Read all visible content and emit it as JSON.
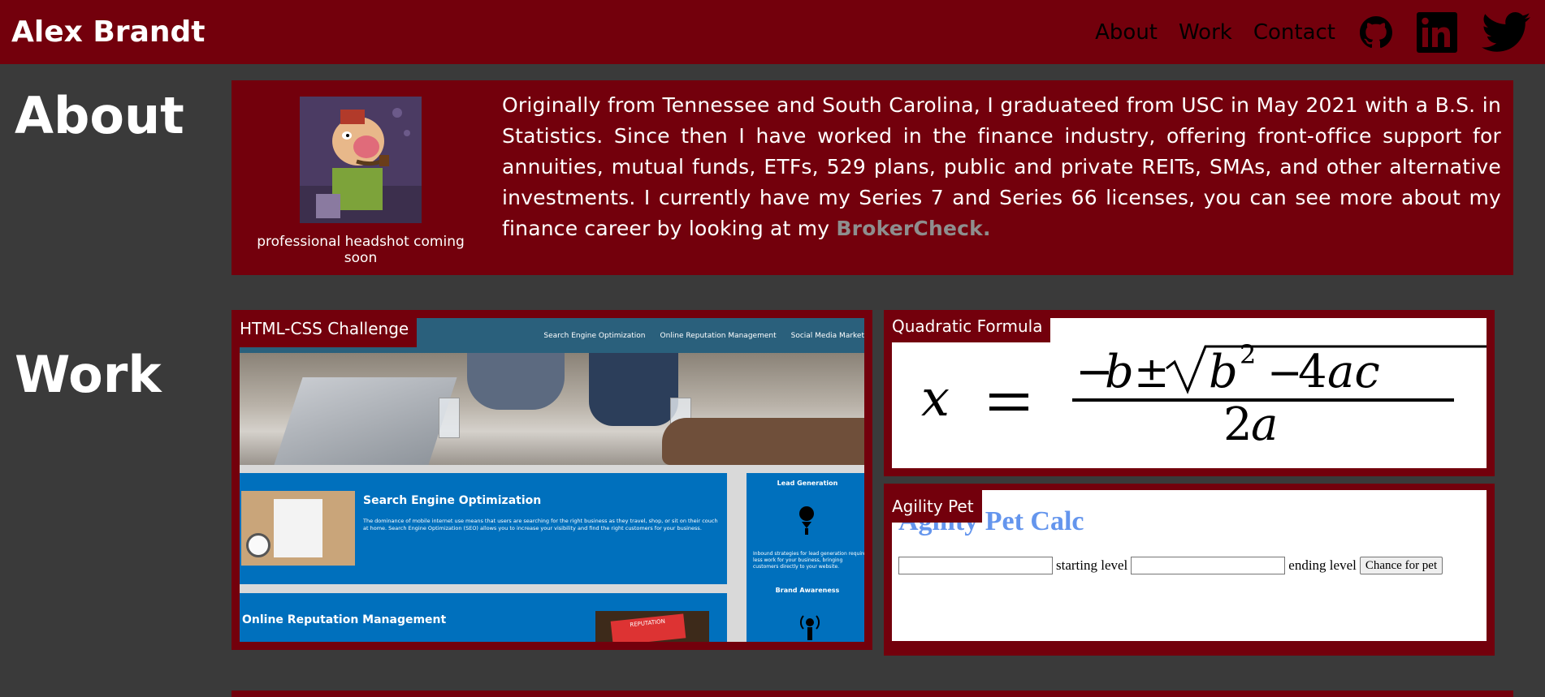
{
  "header": {
    "brand": "Alex Brandt",
    "nav": [
      "About",
      "Work",
      "Contact"
    ],
    "icons": [
      "github-icon",
      "linkedin-icon",
      "twitter-icon"
    ]
  },
  "about": {
    "heading": "About",
    "headshot_caption": "professional headshot coming soon",
    "text": "Originally from Tennessee and South Carolina, I graduateed from USC in May 2021 with a B.S. in Statistics. Since then I have worked in the finance industry, offering front-office support for annuities, mutual funds, ETFs, 529 plans, public and private REITs, SMAs, and other alternative investments. I currently have my Series 7 and Series 66 licenses, you can see more about my finance career by looking at my ",
    "link_text": "BrokerCheck."
  },
  "work": {
    "heading": "Work",
    "projects": [
      {
        "label": "HTML-CSS Challenge",
        "shot": {
          "nav": [
            "Search Engine Optimization",
            "Online Reputation Management",
            "Social Media Market"
          ],
          "seo_title": "Search Engine Optimization",
          "seo_text": "The dominance of mobile internet use means that users are searching for the right business as they travel, shop, or sit on their couch at home. Search Engine Optimization (SEO) allows you to increase your visibility and find the right customers for your business.",
          "side_h1": "Lead Generation",
          "side_text": "Inbound strategies for lead generation require less work for your business, bringing customers directly to your website.",
          "side_h2": "Brand Awareness",
          "orm_title": "Online Reputation Management",
          "orm_img_text": "REPUTATION"
        }
      },
      {
        "label": "Quadratic Formula"
      },
      {
        "label": "Agility Pet",
        "app_title": "Agility Pet Calc",
        "starting_label": "starting level",
        "ending_label": "ending level",
        "button": "Chance for pet"
      }
    ]
  },
  "colors": {
    "accent": "#73000c",
    "background": "#3a3a3a",
    "link": "#8e8e8e"
  }
}
